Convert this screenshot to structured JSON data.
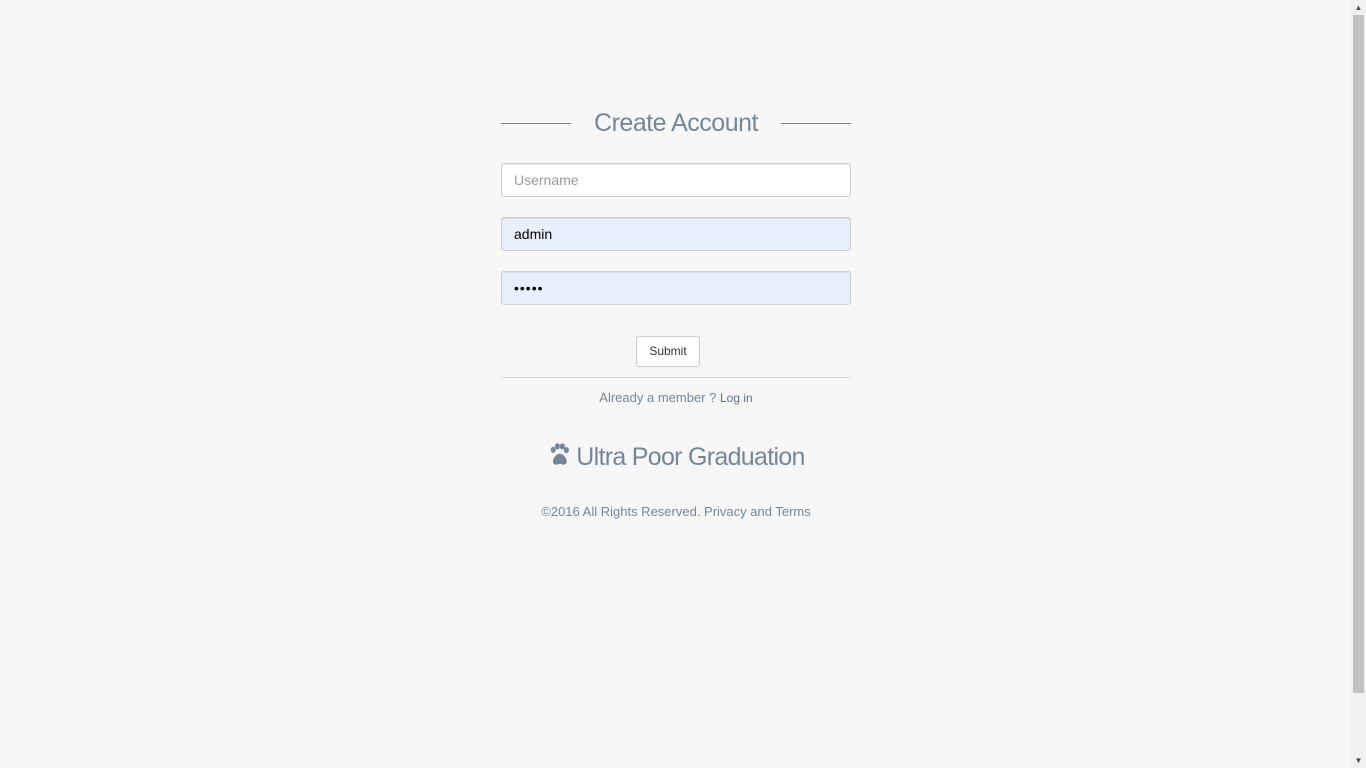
{
  "form": {
    "title": "Create Account",
    "username_placeholder": "Username",
    "email_value": "admin",
    "password_value": "•••••",
    "submit_label": "Submit"
  },
  "member": {
    "prompt": "Already a member ?",
    "login_label": "Log in"
  },
  "brand": {
    "name": "Ultra Poor Graduation",
    "icon": "paw-icon"
  },
  "footer": {
    "copyright": "©2016 All Rights Reserved. Privacy and Terms"
  },
  "colors": {
    "text_accent": "#73879c",
    "autofill_bg": "#e8f0fe",
    "page_bg": "#f7f7f7"
  }
}
